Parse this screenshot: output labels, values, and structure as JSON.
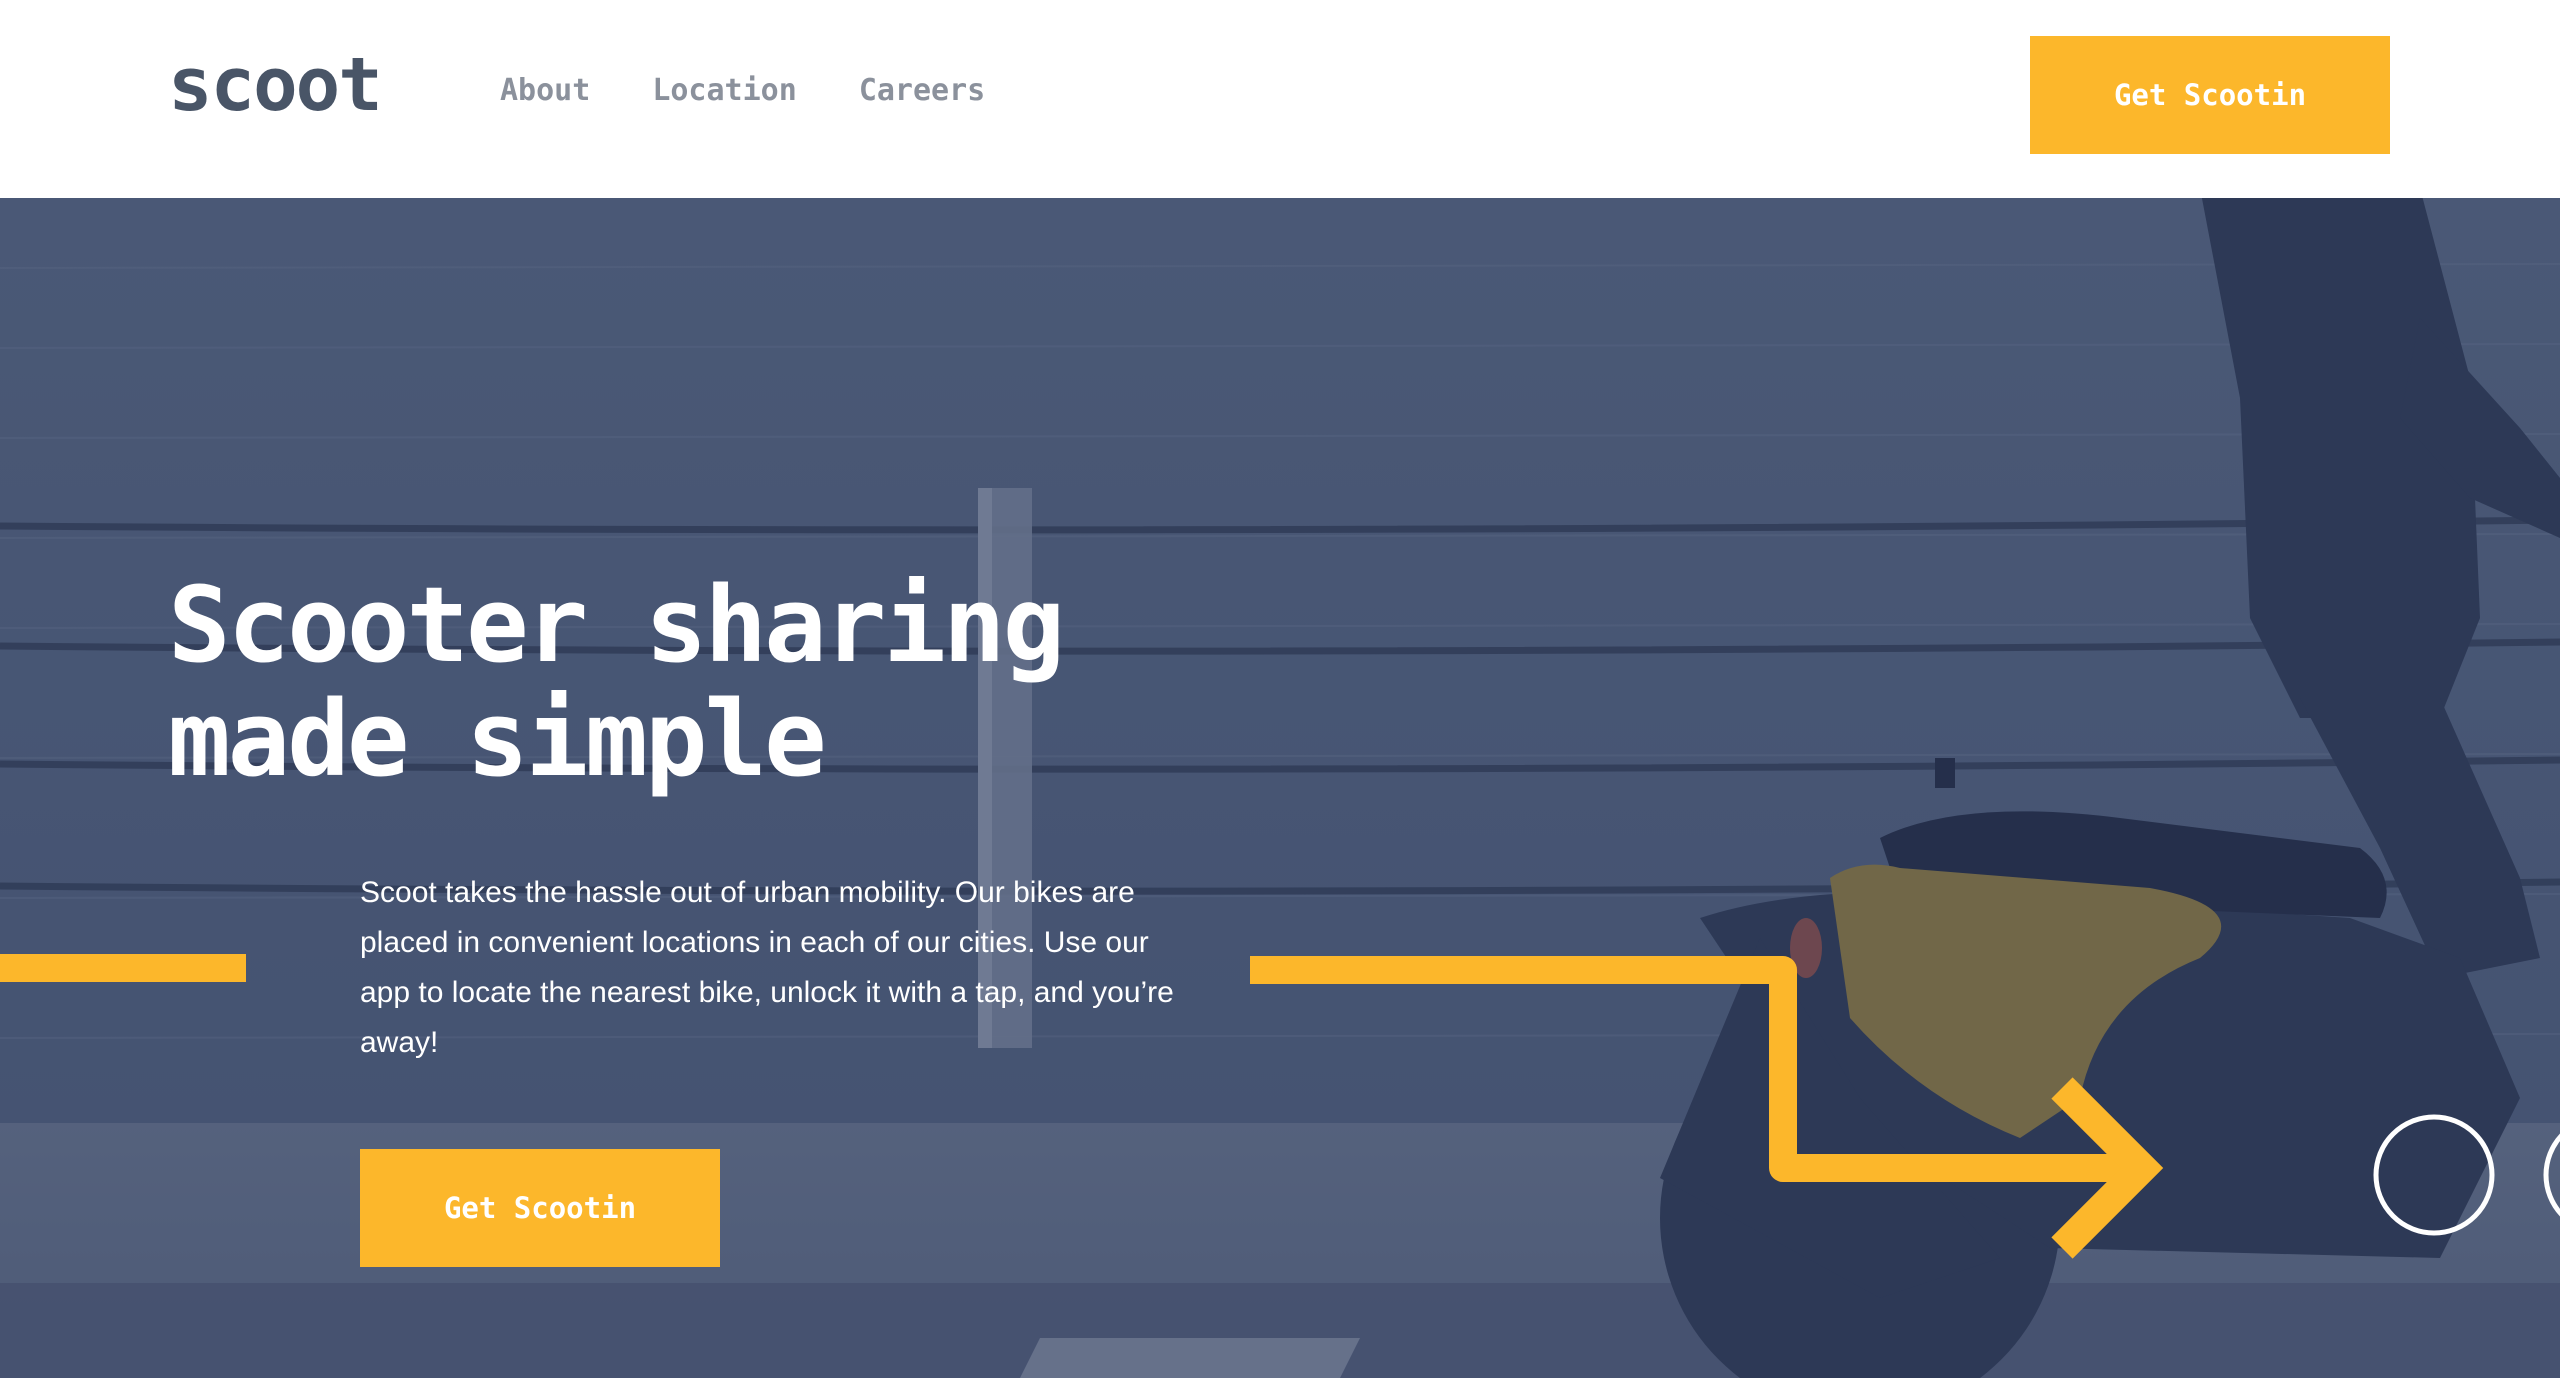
{
  "brand": {
    "logo": "scoot"
  },
  "nav": {
    "items": [
      {
        "label": "About"
      },
      {
        "label": "Location"
      },
      {
        "label": "Careers"
      }
    ],
    "cta_label": "Get Scootin"
  },
  "hero": {
    "headline_line1": "Scooter sharing",
    "headline_line2": "made simple",
    "description": "Scoot takes the hassle out of urban mobility. Our bikes are placed in convenient locations in each of our cities. Use our app to locate the nearest bike, unlock it with a tap, and you’re away!",
    "cta_label": "Get Scootin"
  },
  "colors": {
    "accent": "#fcb72b",
    "dark_navy": "#495567",
    "muted_grey": "#8b919c",
    "hero_overlay": "#4b5874",
    "white": "#ffffff"
  },
  "icons": {
    "decor_line": "yellow-line-decoration",
    "decor_arrow": "yellow-arrow-decoration",
    "decor_circle": "white-circle-decoration"
  }
}
